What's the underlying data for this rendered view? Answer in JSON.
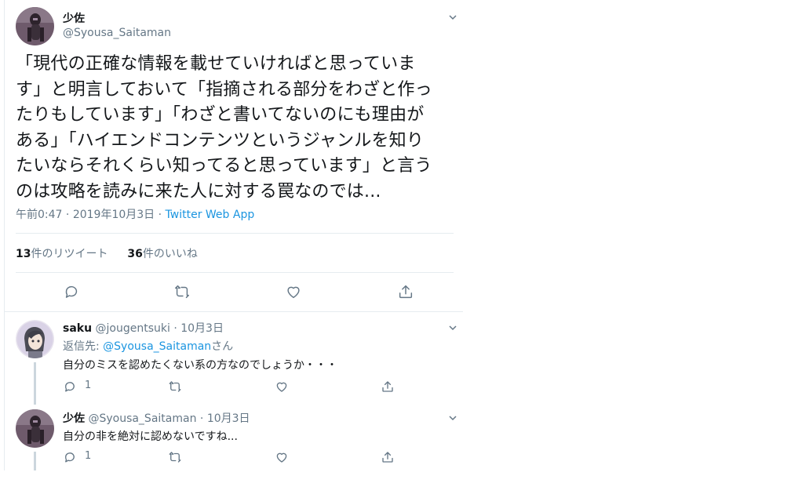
{
  "main_tweet": {
    "author_name": "少佐",
    "author_handle": "@Syousa_Saitaman",
    "lines": [
      "「現代の正確な情報を載せていければと思っていま",
      "す」と明言しておいて「指摘される部分をわざと作っ",
      "たりもしています」「わざと書いてないのにも理由が",
      "ある」「ハイエンドコンテンツというジャンルを知り",
      "たいならそれくらい知ってると思っています」と言う",
      "のは攻略を読みに来た人に対する罠なのでは..."
    ],
    "time": "午前0:47",
    "date": "2019年10月3日",
    "source": "Twitter Web App",
    "retweet_count": "13",
    "retweet_label": "件のリツイート",
    "like_count": "36",
    "like_label": "件のいいね",
    "actions": [
      "reply-icon",
      "retweet-icon",
      "like-icon",
      "share-icon"
    ]
  },
  "replies": [
    {
      "name": "saku",
      "handle": "@jougentsuki",
      "date": "10月3日",
      "reply_to_prefix": "返信先: ",
      "reply_to_handle": "@Syousa_Saitaman",
      "reply_to_suffix": "さん",
      "text": "自分のミスを認めたくない系の方なのでしょうか・・・",
      "reply_count": "1"
    },
    {
      "name": "少佐",
      "handle": "@Syousa_Saitaman",
      "date": "10月3日",
      "text": "自分の非を絶対に認めないですね...",
      "reply_count": "1"
    }
  ],
  "separator": " · ",
  "colors": {
    "link": "#1b95e0",
    "secondary": "#657786",
    "primary": "#14171a",
    "divider": "#e6ecf0"
  }
}
